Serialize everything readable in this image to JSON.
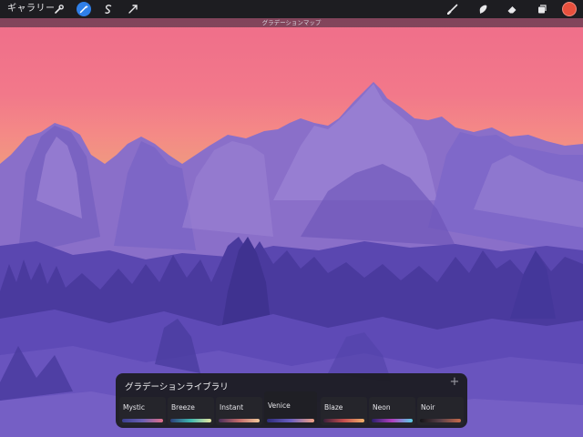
{
  "toolbar": {
    "gallery_label": "ギャラリー",
    "left_icons": [
      "wrench-icon",
      "magic-wand-icon",
      "selection-icon",
      "transform-arrow-icon"
    ],
    "active_icon": "magic-wand-icon",
    "right_icons": [
      "brush-icon",
      "smudge-icon",
      "eraser-icon",
      "layers-icon"
    ],
    "color_swatch": "#e8503d"
  },
  "mode_label": "グラデーションマップ",
  "library": {
    "title": "グラデーションライブラリ",
    "add_icon": "plus-icon",
    "gradients": [
      {
        "name": "Mystic",
        "colors": [
          "#3a3f8f",
          "#6a5fb3",
          "#e06f8a"
        ]
      },
      {
        "name": "Breeze",
        "colors": [
          "#2c3f7a",
          "#3fb8b0",
          "#e8e6a0"
        ]
      },
      {
        "name": "Instant",
        "colors": [
          "#4a2f5a",
          "#c26a6a",
          "#f0c89a"
        ]
      },
      {
        "name": "Venice",
        "colors": [
          "#2d2c7a",
          "#6a5ec0",
          "#f1a184"
        ]
      },
      {
        "name": "Blaze",
        "colors": [
          "#3b1f3a",
          "#c44d4d",
          "#f0b06a"
        ]
      },
      {
        "name": "Neon",
        "colors": [
          "#2a1f6a",
          "#b040c0",
          "#5ad0e8"
        ]
      },
      {
        "name": "Noir",
        "colors": [
          "#141418",
          "#5a4048",
          "#c86a4a"
        ]
      }
    ],
    "selected": "Venice"
  }
}
